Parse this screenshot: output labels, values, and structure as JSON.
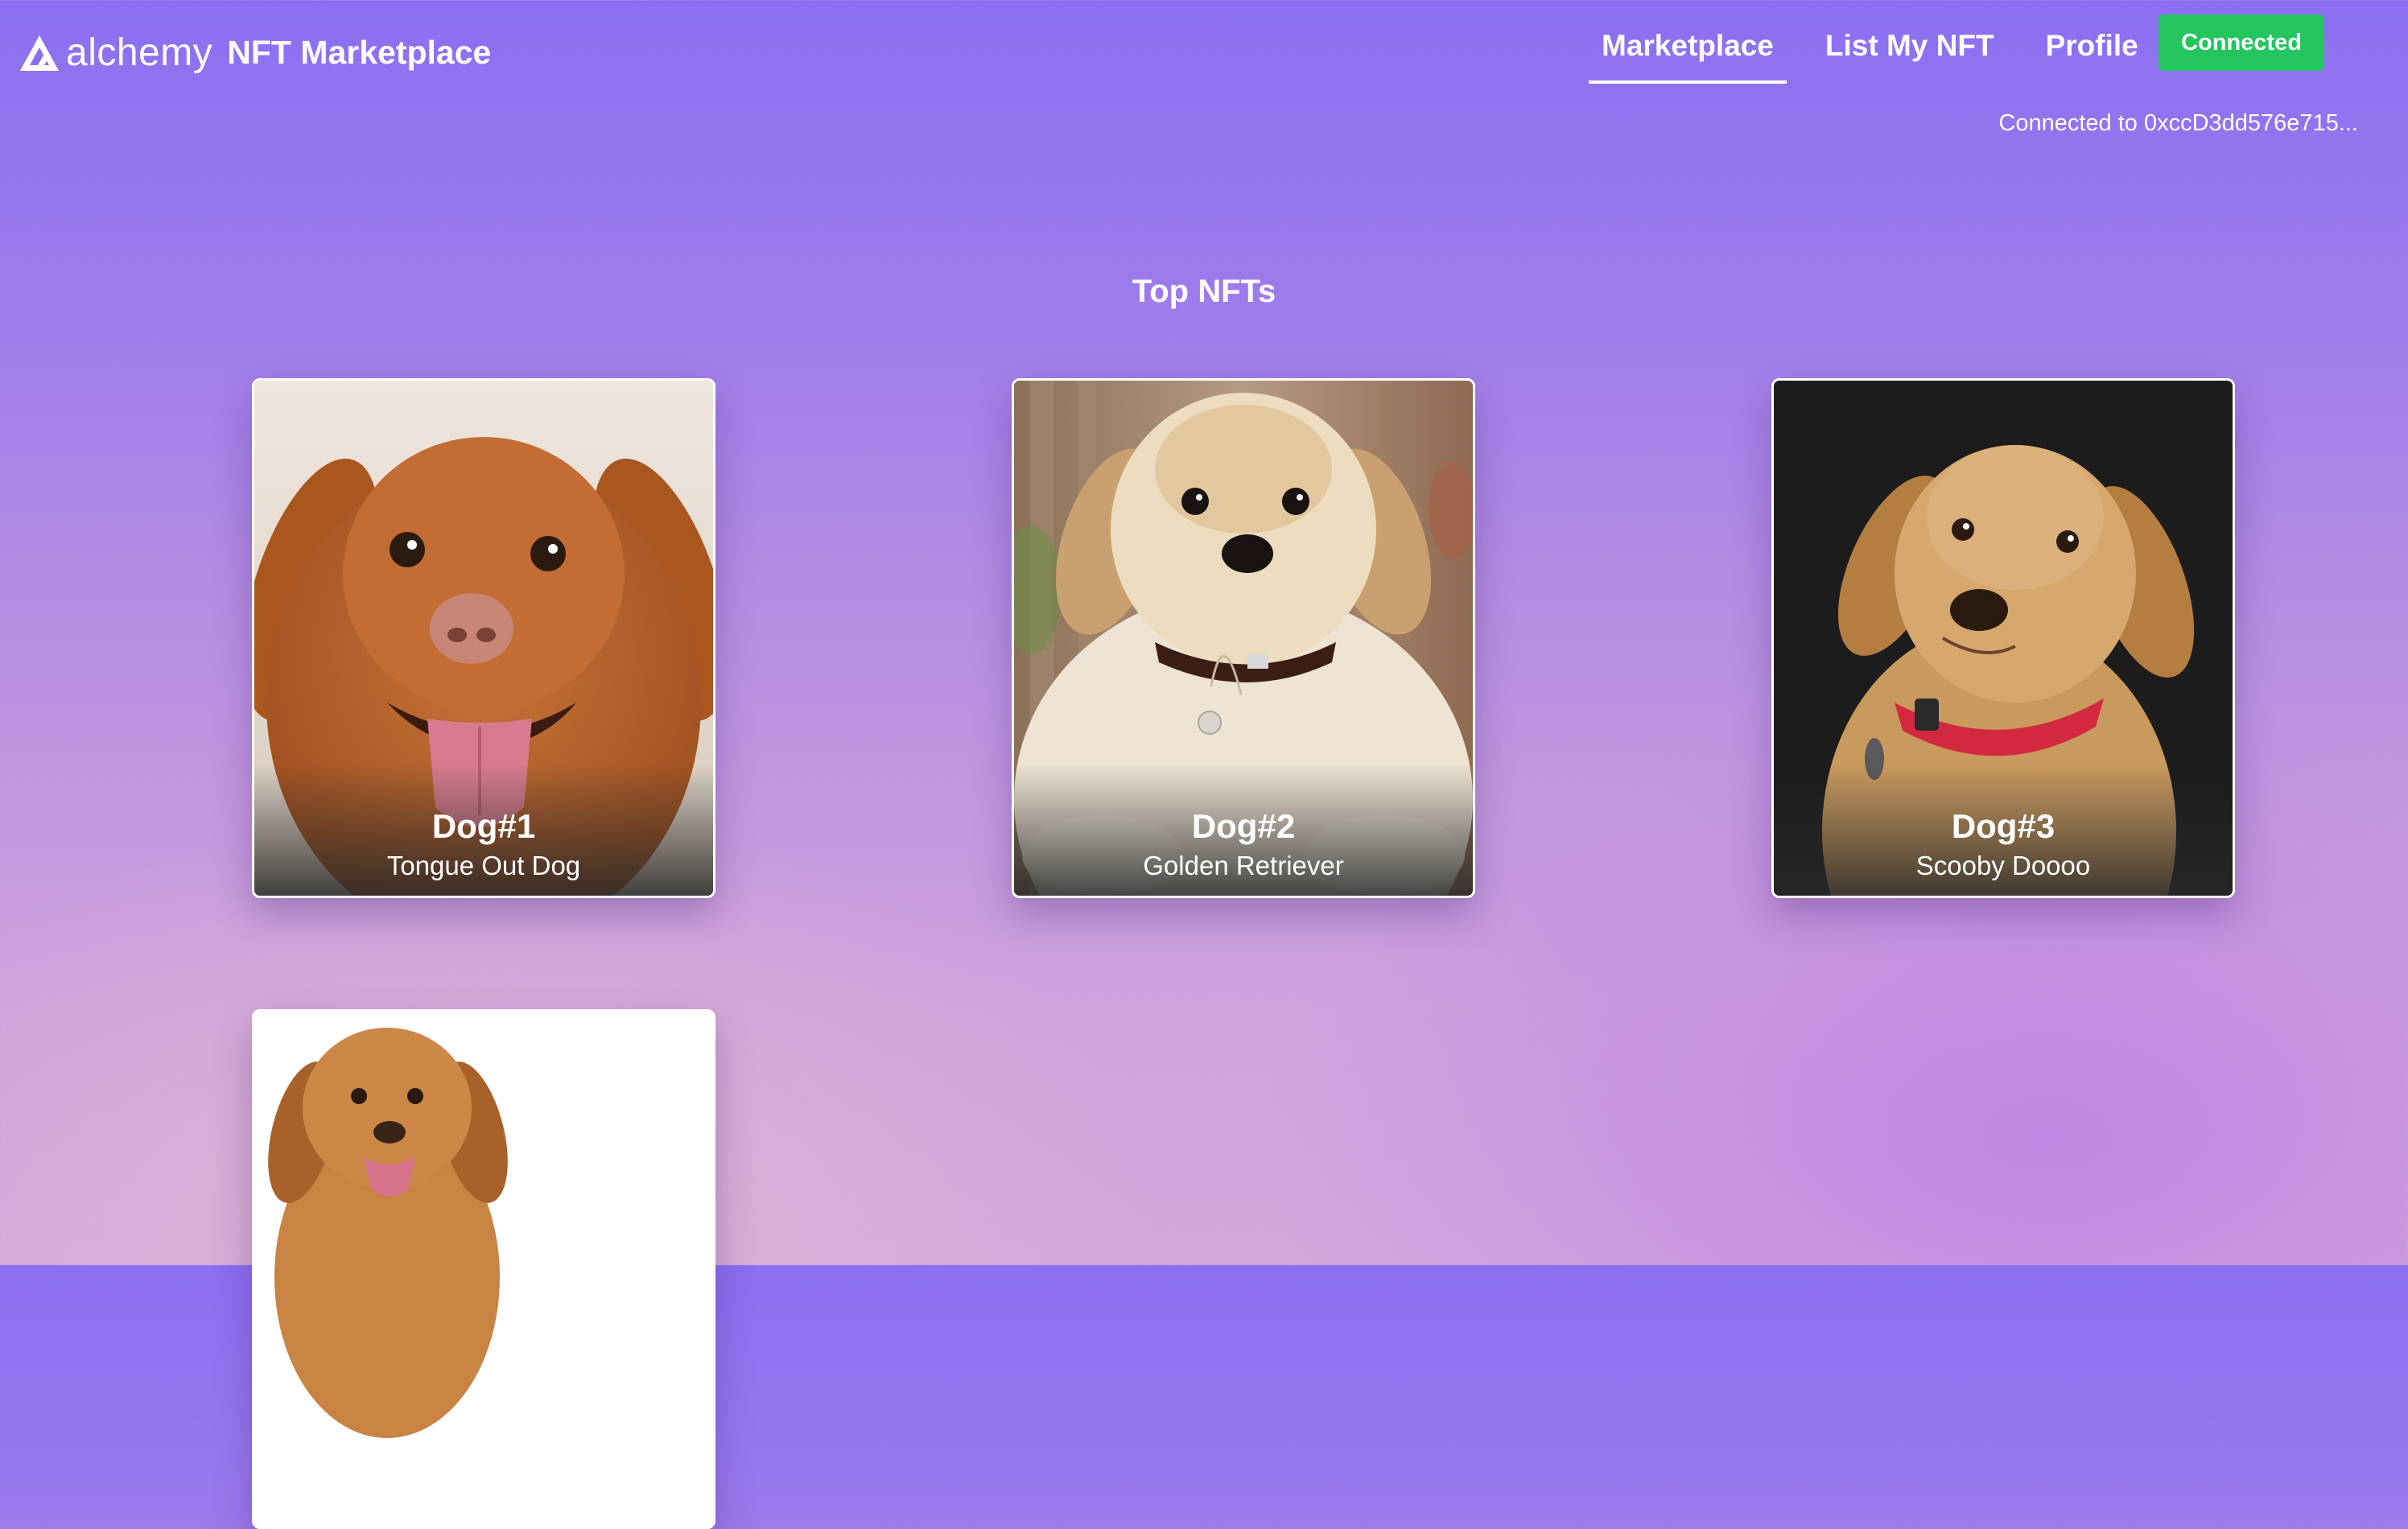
{
  "header": {
    "logo_text": "alchemy",
    "app_title": "NFT Marketplace",
    "nav": [
      {
        "label": "Marketplace",
        "active": true
      },
      {
        "label": "List My NFT",
        "active": false
      },
      {
        "label": "Profile",
        "active": false
      }
    ],
    "connect_button": "Connected",
    "connect_button_color": "#22c55e",
    "connection_status": "Connected to 0xccD3dd576e715..."
  },
  "main": {
    "section_title": "Top NFTs",
    "nfts": [
      {
        "name": "Dog#1",
        "description": "Tongue Out Dog",
        "image": "orange-dog-tongue-out"
      },
      {
        "name": "Dog#2",
        "description": "Golden Retriever",
        "image": "golden-retriever-puppy"
      },
      {
        "name": "Dog#3",
        "description": "Scooby Doooo",
        "image": "labrador-red-collar"
      },
      {
        "name": "",
        "description": "",
        "image": "orange-dog-white-background"
      }
    ]
  }
}
